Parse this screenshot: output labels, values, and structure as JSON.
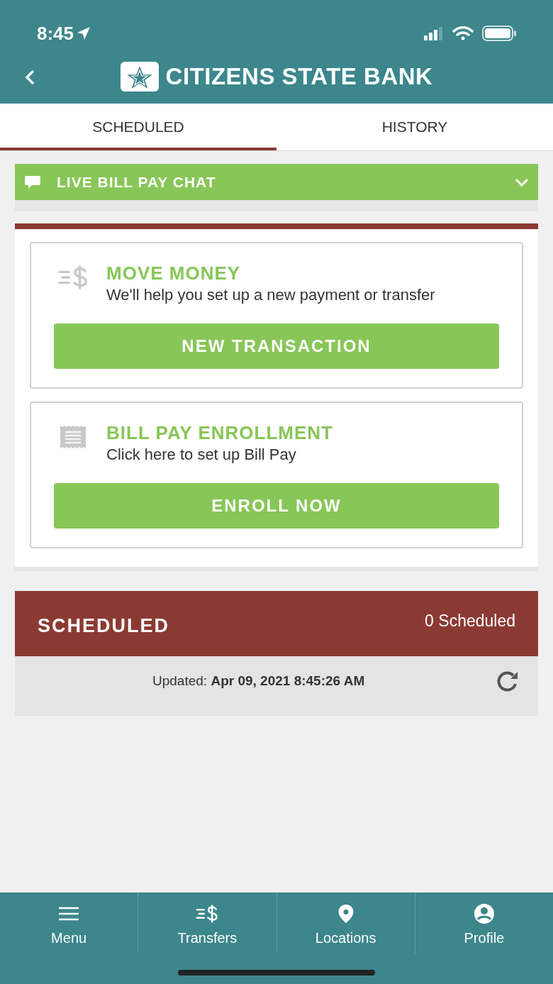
{
  "status_bar": {
    "time": "8:45"
  },
  "header": {
    "title": "CITIZENS STATE BANK"
  },
  "tabs": [
    {
      "label": "SCHEDULED",
      "selected": true
    },
    {
      "label": "HISTORY",
      "selected": false
    }
  ],
  "chat_bar": {
    "label": "LIVE BILL PAY CHAT",
    "expanded": false
  },
  "cards": [
    {
      "kind": "transfer",
      "title": "MOVE MONEY",
      "description": "We'll help you set up a new payment or transfer",
      "button": "NEW TRANSACTION"
    },
    {
      "kind": "bill",
      "title": "BILL PAY ENROLLMENT",
      "description": "Click here to set up Bill Pay",
      "button": "ENROLL NOW"
    }
  ],
  "scheduled": {
    "title": "SCHEDULED",
    "count": "0 Scheduled",
    "updated_label": "Updated:",
    "updated_value": "Apr 09, 2021 8:45:26 AM"
  },
  "bottom_nav": [
    {
      "kind": "menu",
      "label": "Menu"
    },
    {
      "kind": "transfer",
      "label": "Transfers"
    },
    {
      "kind": "location",
      "label": "Locations"
    },
    {
      "kind": "profile",
      "label": "Profile"
    }
  ]
}
